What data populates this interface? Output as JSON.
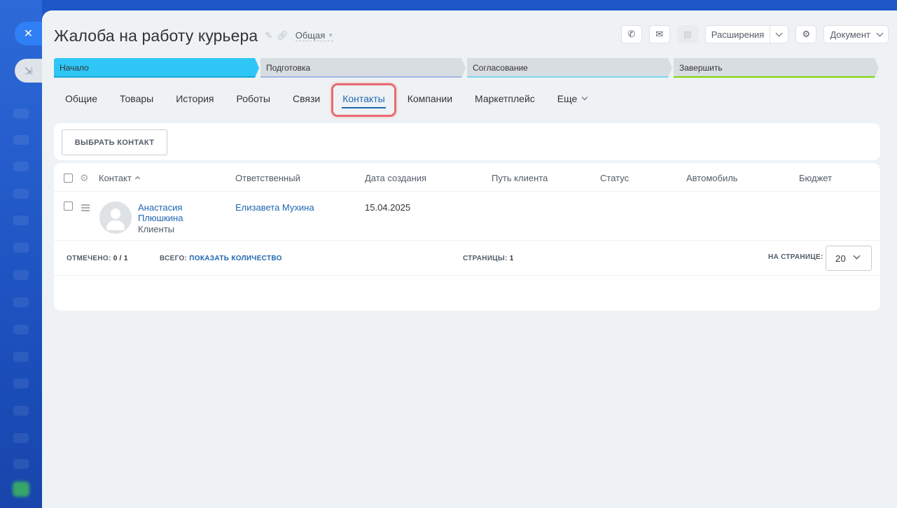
{
  "entity": {
    "title": "Жалоба на работу курьера",
    "category": "Общая"
  },
  "toolbar": {
    "extensions_label": "Расширения",
    "document_label": "Документ"
  },
  "stages": [
    {
      "label": "Начало"
    },
    {
      "label": "Подготовка"
    },
    {
      "label": "Согласование"
    },
    {
      "label": "Завершить"
    }
  ],
  "tabs": [
    {
      "label": "Общие"
    },
    {
      "label": "Товары"
    },
    {
      "label": "История"
    },
    {
      "label": "Роботы"
    },
    {
      "label": "Связи"
    },
    {
      "label": "Контакты",
      "active": true
    },
    {
      "label": "Компании"
    },
    {
      "label": "Маркетплейс"
    },
    {
      "label": "Еще"
    }
  ],
  "actions": {
    "select_contact": "ВЫБРАТЬ КОНТАКТ"
  },
  "table": {
    "columns": [
      "Контакт",
      "Ответственный",
      "Дата создания",
      "Путь клиента",
      "Статус",
      "Автомобиль",
      "Бюджет"
    ],
    "rows": [
      {
        "contact_name": "Анастасия Плюшкина",
        "contact_type": "Клиенты",
        "responsible": "Елизавета Мухина",
        "created": "15.04.2025"
      }
    ]
  },
  "footer": {
    "selected_label": "ОТМЕЧЕНО:",
    "selected_value": "0 / 1",
    "total_label": "ВСЕГО:",
    "total_link": "ПОКАЗАТЬ КОЛИЧЕСТВО",
    "pages_label": "СТРАНИЦЫ:",
    "pages_value": "1",
    "per_page_label": "НА СТРАНИЦЕ:",
    "per_page_value": "20"
  },
  "colors": {
    "accent": "#2067b0",
    "stage_active": "#2fc6f6",
    "highlight": "#e96a72"
  }
}
